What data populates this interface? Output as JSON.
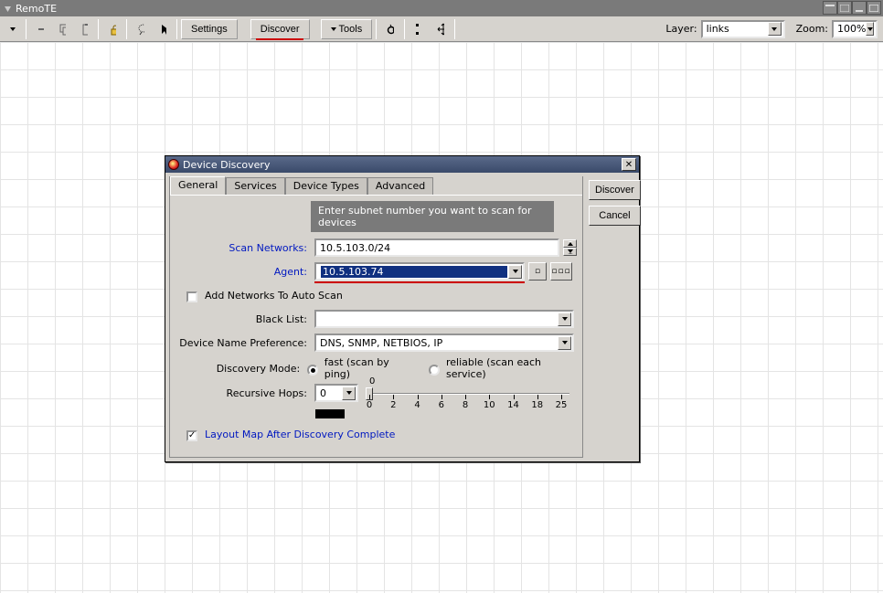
{
  "window": {
    "title": "RemoTE"
  },
  "toolbar": {
    "settings": "Settings",
    "discover": "Discover",
    "tools": "Tools",
    "layer_label": "Layer:",
    "layer_value": "links",
    "zoom_label": "Zoom:",
    "zoom_value": "100%"
  },
  "dialog": {
    "title": "Device Discovery",
    "tabs": {
      "general": "General",
      "services": "Services",
      "device_types": "Device Types",
      "advanced": "Advanced"
    },
    "hint": "Enter subnet number you want to scan for devices",
    "labels": {
      "scan_networks": "Scan Networks:",
      "agent": "Agent:",
      "add_auto": "Add Networks To Auto Scan",
      "black_list": "Black List:",
      "dev_name_pref": "Device Name Preference:",
      "discovery_mode": "Discovery Mode:",
      "fast": "fast (scan by ping)",
      "reliable": "reliable (scan each service)",
      "recursive_hops": "Recursive Hops:",
      "layout_after": "Layout Map After Discovery Complete"
    },
    "values": {
      "scan_networks": "10.5.103.0/24",
      "agent": "10.5.103.74",
      "dev_name_pref": "DNS, SNMP, NETBIOS, IP",
      "recursive_hops": "0"
    },
    "slider": {
      "ticks": [
        "0",
        "2",
        "4",
        "6",
        "8",
        "10",
        "14",
        "18",
        "25"
      ],
      "top_label": "0"
    },
    "buttons": {
      "discover": "Discover",
      "cancel": "Cancel",
      "ellipsis": "▫▫▫",
      "dot": "▫"
    }
  }
}
